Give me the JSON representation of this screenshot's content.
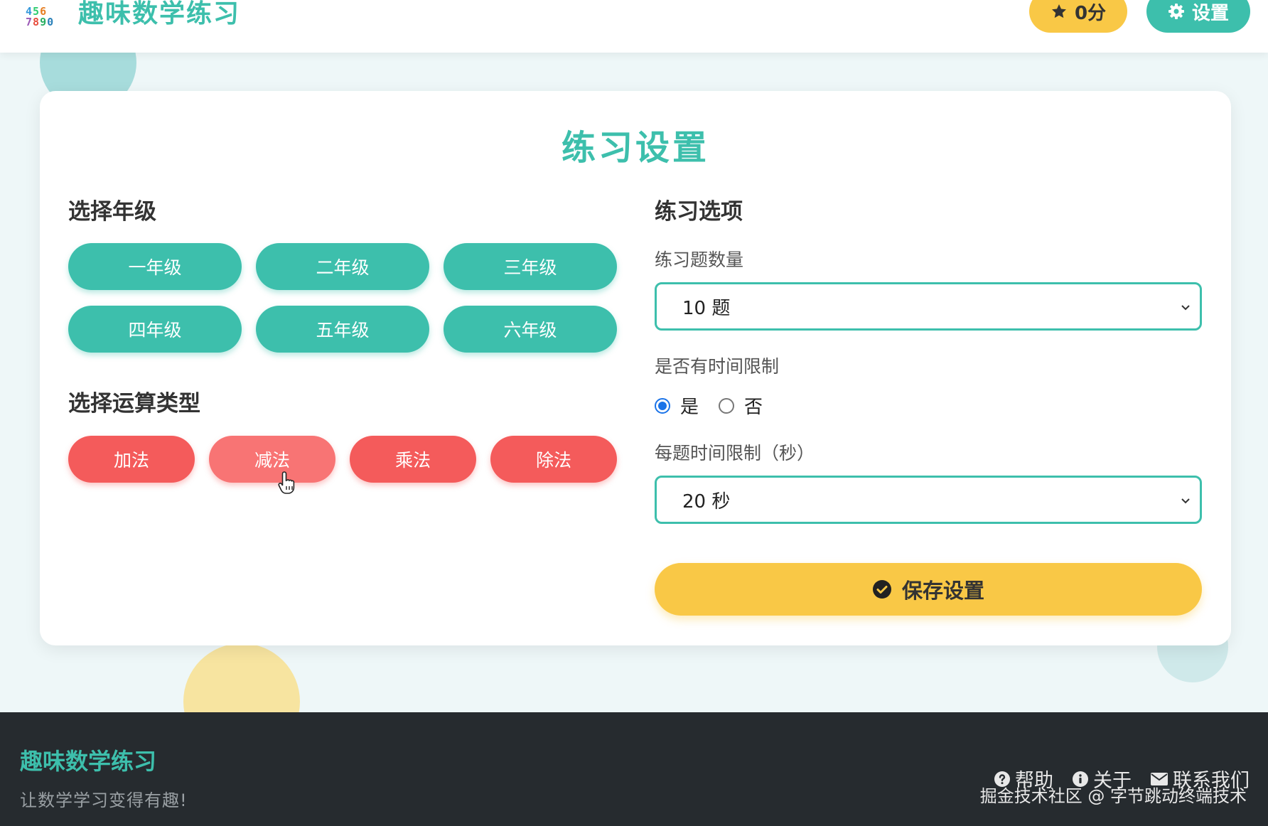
{
  "header": {
    "logo_rows": [
      "  ",
      "456",
      "7890"
    ],
    "title": "趣味数学练习",
    "score": "0分",
    "settings": "设置"
  },
  "card": {
    "title": "练习设置",
    "grade_section": {
      "title": "选择年级",
      "grades": [
        "一年级",
        "二年级",
        "三年级",
        "四年级",
        "五年级",
        "六年级"
      ]
    },
    "operation_section": {
      "title": "选择运算类型",
      "operations": [
        "加法",
        "减法",
        "乘法",
        "除法"
      ],
      "hovered": "减法"
    },
    "options_section": {
      "title": "练习选项",
      "count_label": "练习题数量",
      "count_value": "10 题",
      "time_limit_label": "是否有时间限制",
      "time_limit_yes": "是",
      "time_limit_no": "否",
      "time_limit_selected": "是",
      "per_question_label": "每题时间限制（秒）",
      "per_question_value": "20 秒",
      "save": "保存设置"
    }
  },
  "footer": {
    "title": "趣味数学练习",
    "subtitle": "让数学学习变得有趣!",
    "links": [
      "帮助",
      "关于",
      "联系我们"
    ],
    "watermark": "掘金技术社区 @ 字节跳动终端技术"
  },
  "colors": {
    "teal": "#3dbfac",
    "coral": "#f45b5b",
    "yellow": "#f9c846",
    "footer_bg": "#262b2f"
  },
  "icons": {
    "score": "star-icon",
    "settings": "gear-icon",
    "save": "check-circle-icon",
    "help": "question-circle-icon",
    "about": "info-circle-icon",
    "contact": "envelope-icon"
  }
}
